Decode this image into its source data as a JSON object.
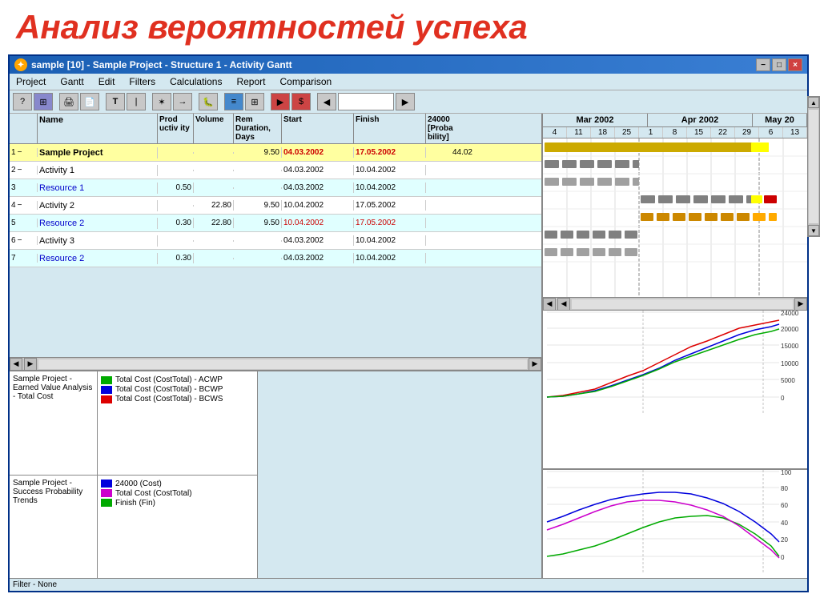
{
  "title": {
    "heading": "Анализ вероятностей успеха",
    "window": "sample [10] - Sample Project - Structure 1 - Activity Gantt"
  },
  "menu": {
    "items": [
      "Project",
      "Gantt",
      "Edit",
      "Filters",
      "Calculations",
      "Report",
      "Comparison"
    ]
  },
  "table": {
    "headers": {
      "name": "Name",
      "productivity": "Prod uctiv ity",
      "volume": "Volume",
      "rem_duration": "Rem Duration, Days",
      "start": "Start",
      "finish": "Finish",
      "probability": "24000 [Proba bility]"
    },
    "rows": [
      {
        "id": "1",
        "dash": "−",
        "name": "Sample Project",
        "productivity": "",
        "volume": "",
        "rem_duration": "9.50",
        "start": "04.03.2002",
        "finish": "17.05.2002",
        "probability": "44.02",
        "type": "project"
      },
      {
        "id": "2",
        "dash": "−",
        "name": "Activity 1",
        "productivity": "",
        "volume": "",
        "rem_duration": "",
        "start": "04.03.2002",
        "finish": "10.04.2002",
        "probability": "",
        "type": "activity"
      },
      {
        "id": "3",
        "dash": "",
        "name": "Resource 1",
        "productivity": "0.50",
        "volume": "",
        "rem_duration": "",
        "start": "04.03.2002",
        "finish": "10.04.2002",
        "probability": "",
        "type": "resource"
      },
      {
        "id": "4",
        "dash": "−",
        "name": "Activity 2",
        "productivity": "",
        "volume": "22.80",
        "rem_duration": "9.50",
        "start": "10.04.2002",
        "finish": "17.05.2002",
        "probability": "",
        "type": "activity"
      },
      {
        "id": "5",
        "dash": "",
        "name": "Resource 2",
        "productivity": "0.30",
        "volume": "22.80",
        "rem_duration": "9.50",
        "start": "10.04.2002",
        "finish": "17.05.2002",
        "probability": "",
        "type": "resource"
      },
      {
        "id": "6",
        "dash": "−",
        "name": "Activity 3",
        "productivity": "",
        "volume": "",
        "rem_duration": "",
        "start": "04.03.2002",
        "finish": "10.04.2002",
        "probability": "",
        "type": "activity"
      },
      {
        "id": "7",
        "dash": "",
        "name": "Resource 2",
        "productivity": "0.30",
        "volume": "",
        "rem_duration": "",
        "start": "04.03.2002",
        "finish": "10.04.2002",
        "probability": "",
        "type": "resource"
      }
    ]
  },
  "gantt": {
    "months": [
      "Mar 2002",
      "Apr 2002",
      "May 20"
    ],
    "weeks": [
      4,
      11,
      18,
      25,
      1,
      8,
      15,
      22,
      29,
      6,
      13
    ]
  },
  "bottom_panels": {
    "earned_value": {
      "title": "Sample Project - Earned Value Analysis - Total Cost",
      "legend": [
        {
          "label": "Total Cost (CostTotal) - ACWP",
          "color": "#00aa00"
        },
        {
          "label": "Total Cost (CostTotal) - BCWP",
          "color": "#0000dd"
        },
        {
          "label": "Total Cost (CostTotal) - BCWS",
          "color": "#dd0000"
        }
      ],
      "axis_labels": [
        "24000",
        "20000",
        "15000",
        "10000",
        "5000",
        "0"
      ]
    },
    "probability": {
      "title": "Sample Project - Success Probability Trends",
      "legend": [
        {
          "label": "24000 (Cost)",
          "color": "#0000dd"
        },
        {
          "label": "Total Cost (CostTotal)",
          "color": "#cc00cc"
        },
        {
          "label": "Finish (Fin)",
          "color": "#00aa00"
        }
      ],
      "axis_labels": [
        "100",
        "80",
        "60",
        "40",
        "20",
        "0"
      ]
    }
  },
  "status": {
    "text": "Filter - None"
  },
  "window_buttons": {
    "minimize": "−",
    "restore": "□",
    "close": "×"
  }
}
